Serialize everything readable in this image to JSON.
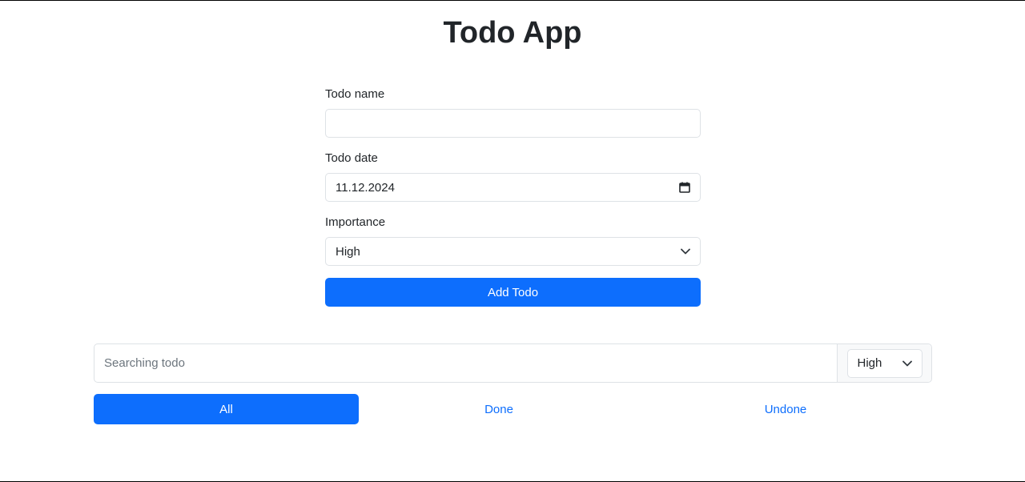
{
  "header": {
    "title": "Todo App"
  },
  "form": {
    "name_label": "Todo name",
    "name_value": "",
    "date_label": "Todo date",
    "date_value": "11.12.2024",
    "importance_label": "Importance",
    "importance_value": "High",
    "add_button_label": "Add Todo"
  },
  "search": {
    "placeholder": "Searching todo",
    "filter_value": "High"
  },
  "filters": {
    "tabs": [
      {
        "label": "All",
        "active": true
      },
      {
        "label": "Done",
        "active": false
      },
      {
        "label": "Undone",
        "active": false
      }
    ]
  },
  "colors": {
    "primary": "#0d6efd",
    "border": "#dee2e6",
    "text": "#212529"
  },
  "icons": {
    "date_field": "calendar-icon",
    "dropdown": "chevron-down-icon"
  }
}
